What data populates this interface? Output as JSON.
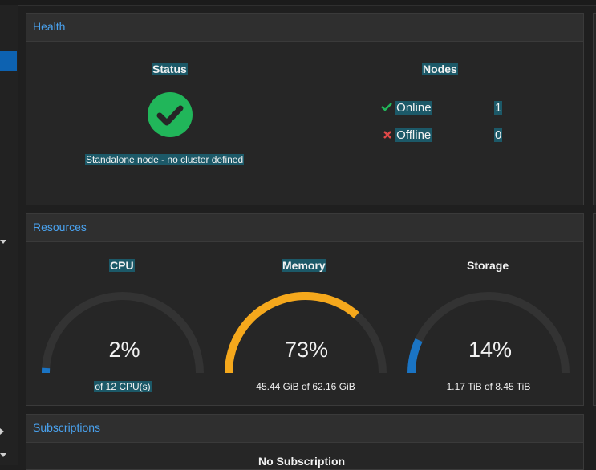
{
  "health": {
    "title": "Health",
    "status_label": "Status",
    "status_text": "Standalone node - no cluster defined",
    "nodes_label": "Nodes",
    "online_label": "Online",
    "online_count": "1",
    "offline_label": "Offline",
    "offline_count": "0"
  },
  "resources": {
    "title": "Resources",
    "cpu": {
      "label": "CPU",
      "percent_text": "2%",
      "percent": 2,
      "detail": "of 12 CPU(s)",
      "color": "#1a74c4"
    },
    "memory": {
      "label": "Memory",
      "percent_text": "73%",
      "percent": 73,
      "detail": "45.44 GiB of 62.16 GiB",
      "color": "#f5a81c"
    },
    "storage": {
      "label": "Storage",
      "percent_text": "14%",
      "percent": 14,
      "detail": "1.17 TiB of 8.45 TiB",
      "color": "#1a74c4"
    }
  },
  "subscriptions": {
    "title": "Subscriptions",
    "status_text": "No Subscription"
  },
  "colors": {
    "accent": "#4aa3f0",
    "ok": "#21b65a",
    "error": "#e04848",
    "gauge_track": "#333333"
  }
}
